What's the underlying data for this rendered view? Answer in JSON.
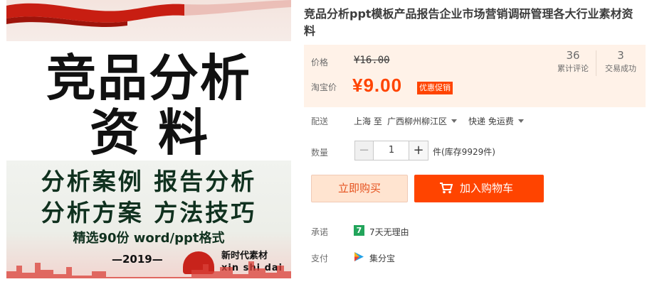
{
  "product_image": {
    "headline_line1": "竞品分析",
    "headline_line2": "资料",
    "tagline_line1": "分析案例  报告分析",
    "tagline_line2": "分析方案  方法技巧",
    "tagline_line3": "精选90份 word/ppt格式",
    "year": "—2019—",
    "brand_cn": "新时代素材",
    "brand_pinyin": "xin shi dai"
  },
  "product": {
    "title": "竞品分析ppt模板产品报告企业市场营销调研管理各大行业素材资料"
  },
  "price": {
    "original_label": "价格",
    "original_value": "¥16.00",
    "current_label": "淘宝价",
    "current_value": "¥9.00",
    "promo_label": "优惠促销"
  },
  "stats": {
    "reviews_count": "36",
    "reviews_label": "累计评论",
    "sales_count": "3",
    "sales_label": "交易成功"
  },
  "delivery": {
    "label": "配送",
    "from": "上海 至",
    "to": "广西柳州柳江区",
    "method": "快递 免运费"
  },
  "quantity": {
    "label": "数量",
    "minus": "−",
    "value": "1",
    "plus": "+",
    "stock": "件(库存9929件)"
  },
  "actions": {
    "buy_now": "立即购买",
    "add_to_cart": "加入购物车"
  },
  "promise": {
    "label": "承诺",
    "icon_text": "7",
    "text": "7天无理由"
  },
  "payment": {
    "label": "支付",
    "text": "集分宝"
  },
  "colors": {
    "accent": "#ff4400",
    "price_bg": "#fff2e8",
    "buy_now_bg": "#ffe4d0"
  }
}
